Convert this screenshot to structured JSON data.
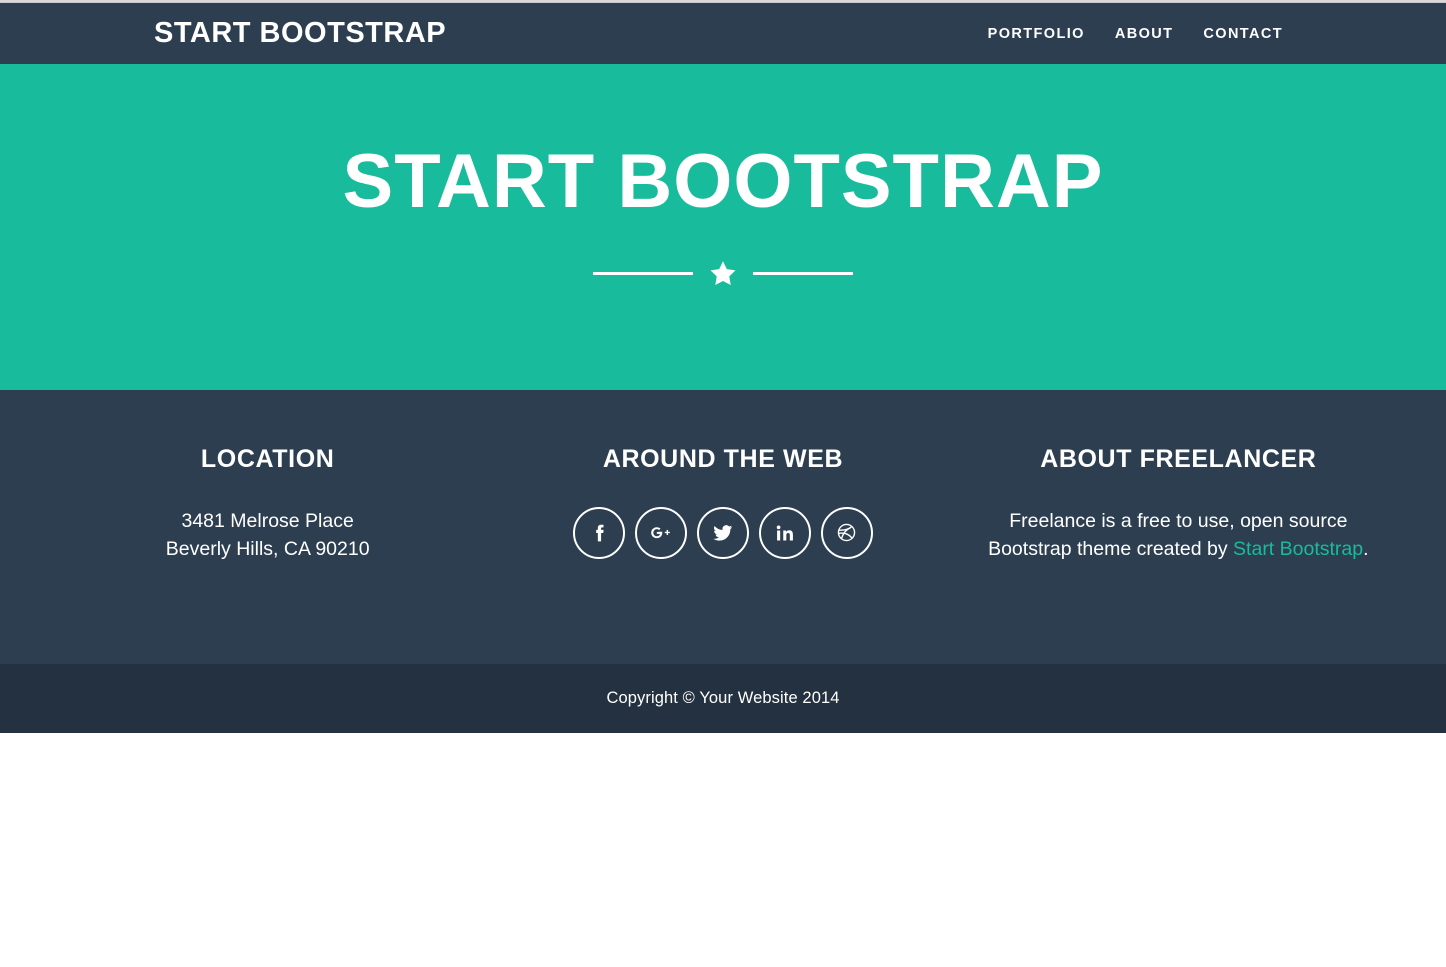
{
  "colors": {
    "navy": "#2C3E50",
    "teal": "#18BC9C",
    "dark_navy": "#233140",
    "white": "#FFFFFF"
  },
  "navbar": {
    "brand": "Start Bootstrap",
    "links": [
      {
        "label": "Portfolio",
        "name": "nav-link-portfolio"
      },
      {
        "label": "About",
        "name": "nav-link-about"
      },
      {
        "label": "Contact",
        "name": "nav-link-contact"
      }
    ]
  },
  "hero": {
    "title": "Start Bootstrap",
    "divider_icon": "star-icon"
  },
  "footer": {
    "location": {
      "heading": "Location",
      "line1": "3481 Melrose Place",
      "line2": "Beverly Hills, CA 90210"
    },
    "social": {
      "heading": "Around the Web",
      "items": [
        {
          "icon": "facebook-icon",
          "label": "Facebook"
        },
        {
          "icon": "google-plus-icon",
          "label": "Google Plus"
        },
        {
          "icon": "twitter-icon",
          "label": "Twitter"
        },
        {
          "icon": "linkedin-icon",
          "label": "LinkedIn"
        },
        {
          "icon": "dribbble-icon",
          "label": "Dribbble"
        }
      ]
    },
    "about": {
      "heading": "About Freelancer",
      "text_before": "Freelance is a free to use, open source Bootstrap theme created by ",
      "link_text": "Start Bootstrap",
      "text_after": "."
    }
  },
  "copyright": {
    "text": "Copyright © Your Website 2014"
  }
}
